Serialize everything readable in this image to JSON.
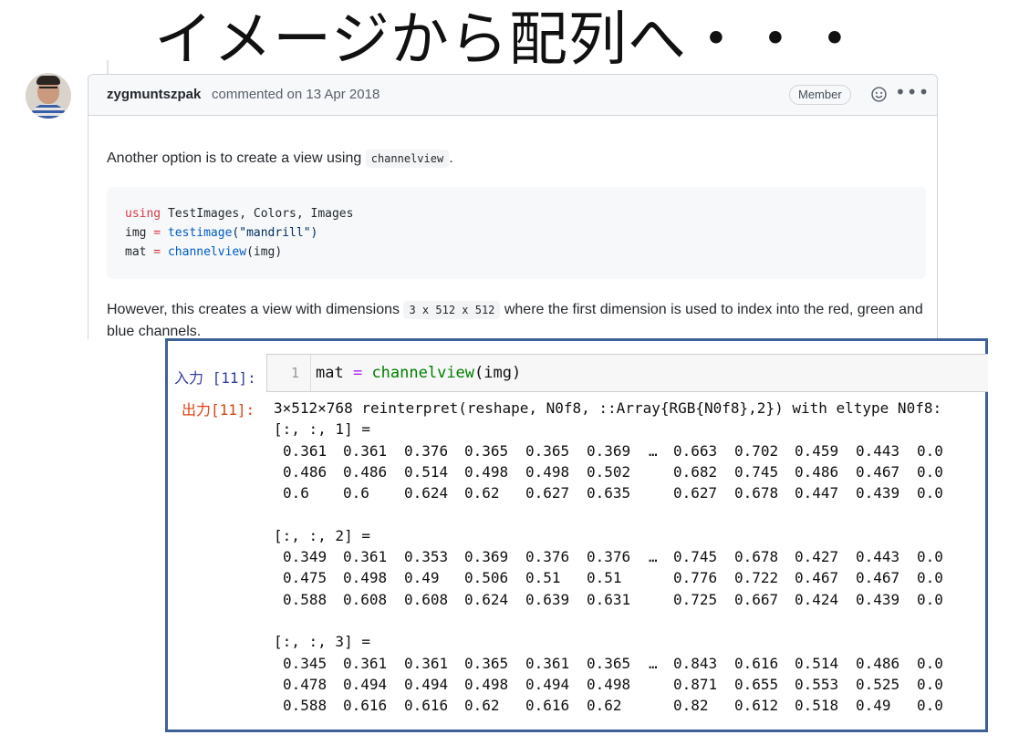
{
  "slide": {
    "title": "イメージから配列へ・・・"
  },
  "comment": {
    "author": "zygmuntszpak",
    "meta": "commented on 13 Apr 2018",
    "badge": "Member",
    "para1_before": "Another option is to create a view using ",
    "para1_code": "channelview",
    "para1_after": ".",
    "code_lines": [
      {
        "kw": "using",
        "rest": " TestImages, Colors, Images"
      },
      {
        "var": "img",
        "op": " = ",
        "fn": "testimage",
        "args": "(\"mandrill\")"
      },
      {
        "var": "mat",
        "op": " = ",
        "fn": "channelview",
        "args": "(img)"
      }
    ],
    "para2_before": "However, this creates a view with dimensions ",
    "para2_code": "3 x 512 x 512",
    "para2_after": " where the first dimension is used to index into the red, green and blue channels."
  },
  "notebook": {
    "in_prompt": "入力 [11]:",
    "line_number": "1",
    "input_var": "mat",
    "input_op": " = ",
    "input_fn": "channelview",
    "input_args": "(img)",
    "out_prompt": "出力[11]:",
    "summary": "3×512×768 reinterpret(reshape, N0f8, ::Array{RGB{N0f8},2}) with eltype N0f8:",
    "slices": [
      {
        "label": "[:, :, 1] =",
        "rows": [
          [
            "0.361",
            "0.361",
            "0.376",
            "0.365",
            "0.365",
            "0.369",
            "…",
            "0.663",
            "0.702",
            "0.459",
            "0.443",
            "0.0"
          ],
          [
            "0.486",
            "0.486",
            "0.514",
            "0.498",
            "0.498",
            "0.502",
            "",
            "0.682",
            "0.745",
            "0.486",
            "0.467",
            "0.0"
          ],
          [
            "0.6",
            "0.6",
            "0.624",
            "0.62",
            "0.627",
            "0.635",
            "",
            "0.627",
            "0.678",
            "0.447",
            "0.439",
            "0.0"
          ]
        ]
      },
      {
        "label": "[:, :, 2] =",
        "rows": [
          [
            "0.349",
            "0.361",
            "0.353",
            "0.369",
            "0.376",
            "0.376",
            "…",
            "0.745",
            "0.678",
            "0.427",
            "0.443",
            "0.0"
          ],
          [
            "0.475",
            "0.498",
            "0.49",
            "0.506",
            "0.51",
            "0.51",
            "",
            "0.776",
            "0.722",
            "0.467",
            "0.467",
            "0.0"
          ],
          [
            "0.588",
            "0.608",
            "0.608",
            "0.624",
            "0.639",
            "0.631",
            "",
            "0.725",
            "0.667",
            "0.424",
            "0.439",
            "0.0"
          ]
        ]
      },
      {
        "label": "[:, :, 3] =",
        "rows": [
          [
            "0.345",
            "0.361",
            "0.361",
            "0.365",
            "0.361",
            "0.365",
            "…",
            "0.843",
            "0.616",
            "0.514",
            "0.486",
            "0.0"
          ],
          [
            "0.478",
            "0.494",
            "0.494",
            "0.498",
            "0.494",
            "0.498",
            "",
            "0.871",
            "0.655",
            "0.553",
            "0.525",
            "0.0"
          ],
          [
            "0.588",
            "0.616",
            "0.616",
            "0.62",
            "0.616",
            "0.62",
            "",
            "0.82",
            "0.612",
            "0.518",
            "0.49",
            "0.0"
          ]
        ]
      }
    ]
  }
}
